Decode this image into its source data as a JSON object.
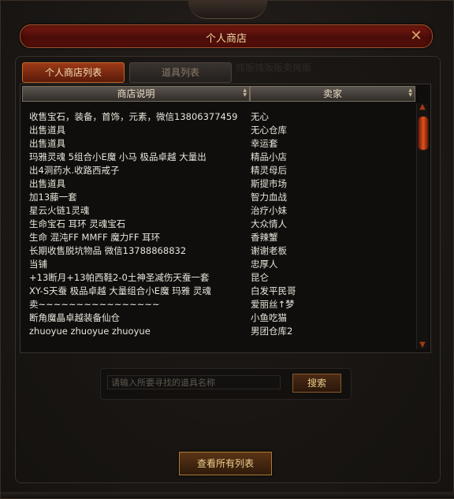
{
  "window": {
    "title": "个人商店",
    "close_symbol": "✕"
  },
  "tabs": [
    {
      "label": "个人商店列表",
      "active": true
    },
    {
      "label": "道具列表",
      "active": false
    }
  ],
  "ghost_text": "摊贩摊贩贩卖摊贩",
  "columns": {
    "desc": "商店说明",
    "seller": "卖家"
  },
  "rows": [
    {
      "desc": "收售宝石，装备，首饰，元素，微信13806377459",
      "seller": "无心"
    },
    {
      "desc": "出售道具",
      "seller": "无心仓库"
    },
    {
      "desc": "出售道具",
      "seller": "幸运套"
    },
    {
      "desc": "玛雅灵魂  5组合小E魔  小马  极品卓越  大量出",
      "seller": "精品小店"
    },
    {
      "desc": "出4洞药水.收路西戒子",
      "seller": "精灵母后"
    },
    {
      "desc": "出售道具",
      "seller": "斯提市场"
    },
    {
      "desc": "加13藤一套",
      "seller": "智力血战"
    },
    {
      "desc": "星云火链1灵魂",
      "seller": "治疗小妹"
    },
    {
      "desc": "生命宝石 耳环 灵魂宝石",
      "seller": "大众情人"
    },
    {
      "desc": "生命 混沌FF MMFF 魔力FF 耳环",
      "seller": "香辣蟹"
    },
    {
      "desc": "长期收售脱坑物品 微信13788868832",
      "seller": "谢谢老板"
    },
    {
      "desc": "当铺",
      "seller": "忠厚人"
    },
    {
      "desc": "+13断月+13帕西鞋2-0土神圣减伤天蚕一套",
      "seller": "昆仑"
    },
    {
      "desc": "XY-S天蚕 极品卓越 大量组合小E魔 玛雅 灵魂",
      "seller": "白发平民哥"
    },
    {
      "desc": "卖~~~~~~~~~~~~~~~~",
      "seller": "爱丽丝↑梦"
    },
    {
      "desc": "断角魔晶卓越装备仙仓",
      "seller": "小鱼吃猫"
    },
    {
      "desc": "zhuoyue zhuoyue zhuoyue",
      "seller": "男团仓库2"
    }
  ],
  "search": {
    "placeholder": "请输入所要寻找的道具名称",
    "value": "",
    "button": "搜索"
  },
  "view_all_button": "查看所有列表",
  "scroll": {
    "up": "▲",
    "down": "▼"
  },
  "colors": {
    "accent": "#a3552c",
    "title_text": "#f1d9a0",
    "row_text": "#e9e4da"
  }
}
